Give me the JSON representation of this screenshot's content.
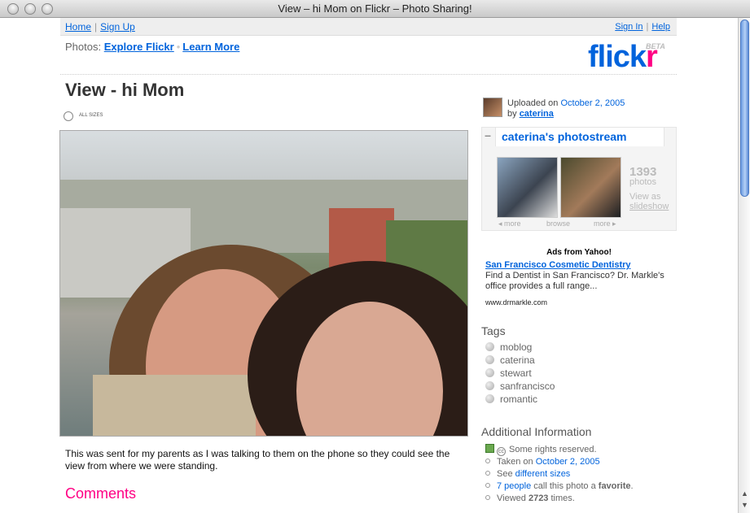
{
  "window": {
    "title": "View – hi Mom on Flickr – Photo Sharing!"
  },
  "topnav": {
    "home": "Home",
    "signup": "Sign Up",
    "signin": "Sign In",
    "help": "Help"
  },
  "explore": {
    "prefix": "Photos:",
    "explore_link": "Explore Flickr",
    "learn_link": "Learn More"
  },
  "logo": {
    "text_a": "flick",
    "text_b": "r",
    "beta": "BETA"
  },
  "photo": {
    "title": "View - hi Mom",
    "allsizes": "ALL SIZES",
    "description": "This was sent for my parents as I was talking to them on the phone so they could see the view from where we were standing."
  },
  "comments": {
    "heading": "Comments"
  },
  "uploader": {
    "uploaded_prefix": "Uploaded on",
    "date": "October 2, 2005",
    "by": "by",
    "user": "caterina"
  },
  "photostream": {
    "title": "caterina's photostream",
    "count": "1393",
    "count_label": "photos",
    "view_as": "View as",
    "slideshow": "slideshow",
    "more_prev": "◂ more",
    "browse": "browse",
    "more_next": "more ▸"
  },
  "ads": {
    "heading": "Ads from Yahoo!",
    "title": "San Francisco Cosmetic Dentistry",
    "text": "Find a Dentist in San Francisco? Dr. Markle's office provides a full range...",
    "url": "www.drmarkle.com"
  },
  "tags": {
    "heading": "Tags",
    "items": [
      "moblog",
      "caterina",
      "stewart",
      "sanfrancisco",
      "romantic"
    ]
  },
  "info": {
    "heading": "Additional Information",
    "rights": "Some rights reserved.",
    "taken_prefix": "Taken on",
    "taken_date": "October 2, 2005",
    "sizes_prefix": "See",
    "sizes_link": "different sizes",
    "fav_link": "7 people",
    "fav_mid": "call this photo a",
    "fav_word": "favorite",
    "fav_end": ".",
    "viewed_prefix": "Viewed",
    "viewed_count": "2723",
    "viewed_suffix": "times."
  },
  "colors": {
    "flickr_blue": "#0063dc",
    "flickr_pink": "#ff0084"
  }
}
